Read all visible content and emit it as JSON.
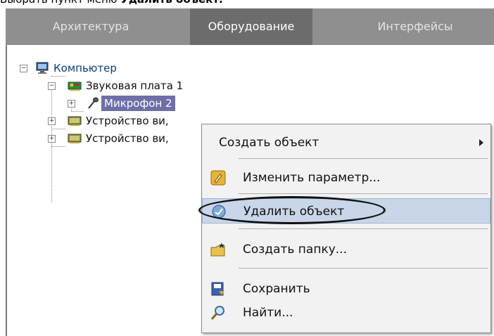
{
  "caption": {
    "prefix": "Выбрать пункт меню ",
    "bold": "Удалить объект."
  },
  "tabs": [
    {
      "label": "Архитектура",
      "active": false
    },
    {
      "label": "Оборудование",
      "active": true
    },
    {
      "label": "Интерфейсы",
      "active": false
    }
  ],
  "tree": {
    "root": "Компьютер",
    "sound_card": "Звуковая плата 1",
    "microphone": "Микрофон 2",
    "video1": "Устройство ви,",
    "video2": "Устройство ви,"
  },
  "context_menu": {
    "create_object": "Создать объект",
    "change_param": "Изменить параметр...",
    "delete_object": "Удалить объект",
    "create_folder": "Создать папку...",
    "save": "Сохранить",
    "find": "Найти..."
  },
  "colors": {
    "tab_bar": "#8f8f8f",
    "tab_active": "#6c6c6c",
    "selection": "#6e6ea8",
    "menu_highlight": "#c8d6e8"
  }
}
